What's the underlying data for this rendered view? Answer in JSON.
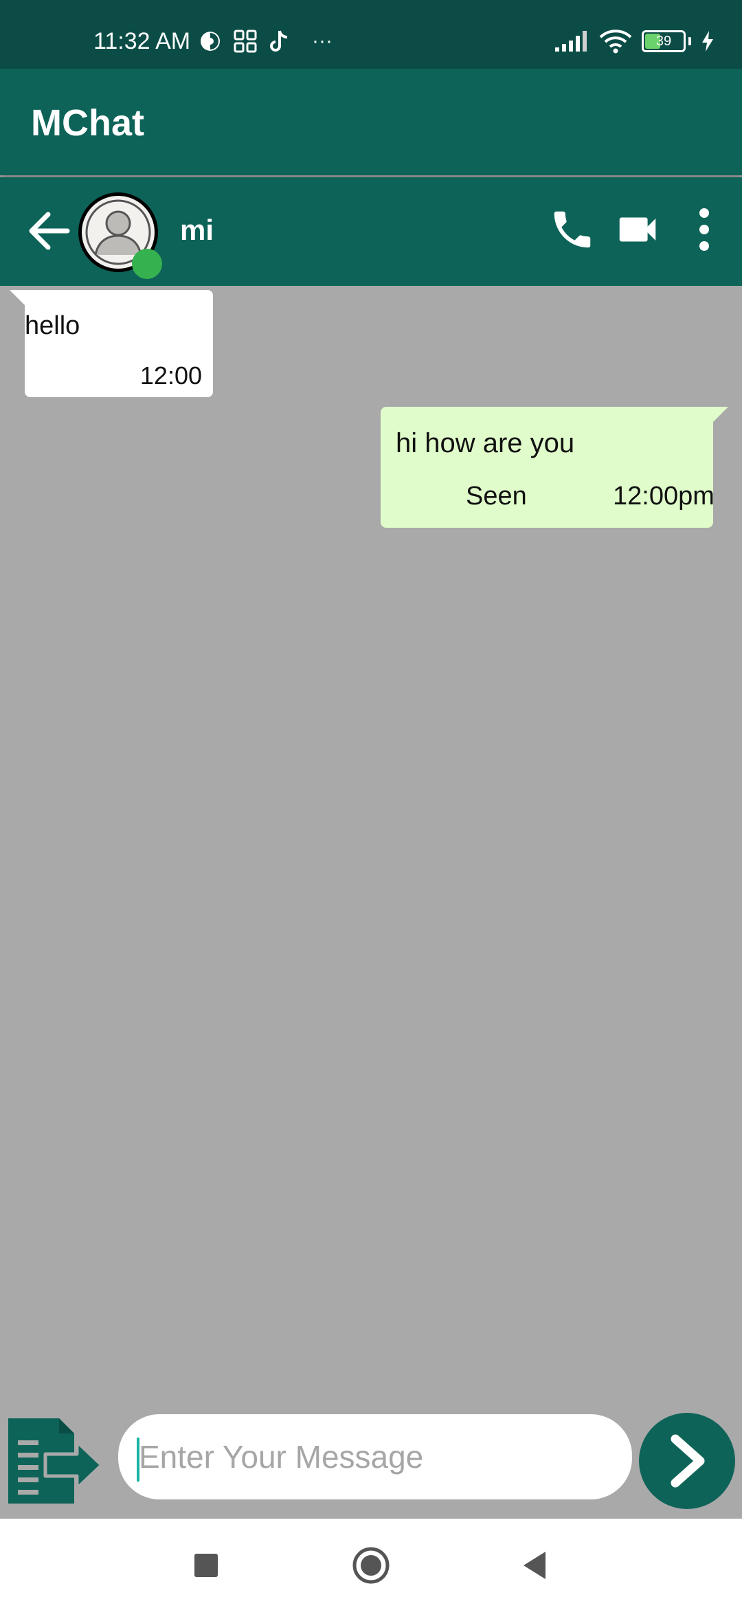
{
  "status_bar": {
    "time": "11:32 AM",
    "more": "···",
    "battery_level": "39",
    "left_icons": [
      "data-saver-icon",
      "grid-apps-icon",
      "tiktok-icon",
      "more-icon"
    ],
    "right_icons": [
      "signal-icon",
      "wifi-icon",
      "battery-icon",
      "charging-bolt-icon"
    ]
  },
  "app_bar": {
    "title": "MChat"
  },
  "chat_header": {
    "contact_name": "mi",
    "online": true,
    "actions": [
      "phone-icon",
      "video-camera-icon",
      "more-vert-icon"
    ]
  },
  "messages": [
    {
      "direction": "incoming",
      "text": "hello",
      "time": "12:00"
    },
    {
      "direction": "outgoing",
      "text": "hi how are you",
      "status": "Seen",
      "time": "12:00pm"
    }
  ],
  "composer": {
    "placeholder": "Enter Your Message",
    "value": ""
  },
  "colors": {
    "status_bar": "#0b4d46",
    "primary": "#0d6358",
    "chat_background": "#a9a9a9",
    "incoming_bubble": "#ffffff",
    "outgoing_bubble": "#e0fcca",
    "online": "#36b14f"
  }
}
